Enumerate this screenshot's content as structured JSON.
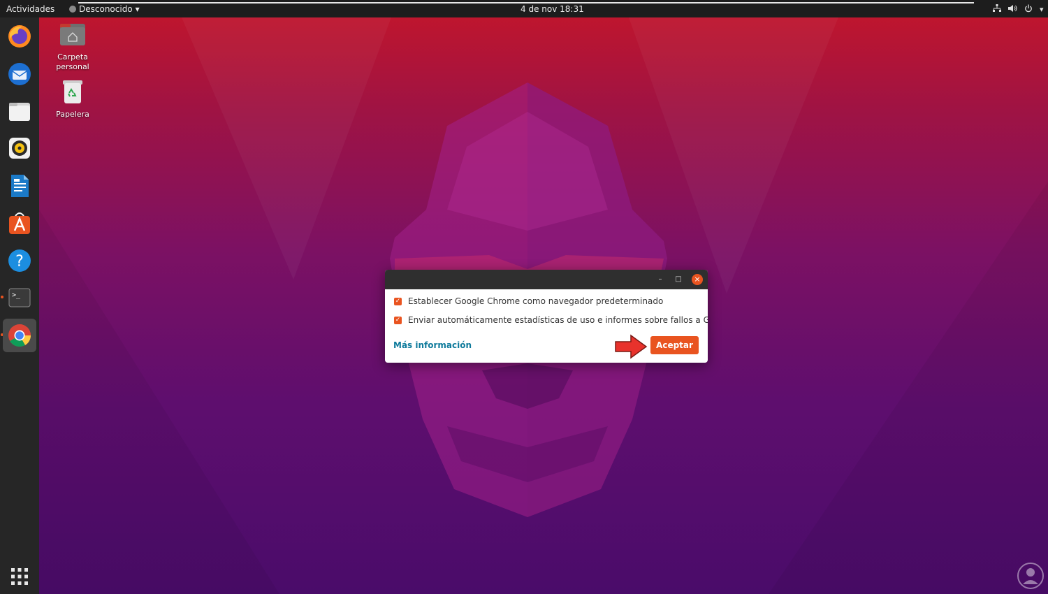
{
  "topbar": {
    "activities": "Actividades",
    "app_name": "Desconocido",
    "app_menu_caret": "▾",
    "clock": "4 de nov  18:31",
    "tray": {
      "network_icon": "network-icon",
      "volume_icon": "volume-icon",
      "power_icon": "power-icon",
      "menu_caret": "▾"
    }
  },
  "dock": {
    "items": [
      {
        "name": "firefox",
        "icon": "firefox-icon",
        "running": false,
        "active": false
      },
      {
        "name": "thunderbird",
        "icon": "thunderbird-icon",
        "running": false,
        "active": false
      },
      {
        "name": "files",
        "icon": "files-icon",
        "running": false,
        "active": false
      },
      {
        "name": "rhythmbox",
        "icon": "rhythmbox-icon",
        "running": false,
        "active": false
      },
      {
        "name": "libreoffice-writer",
        "icon": "writer-icon",
        "running": false,
        "active": false
      },
      {
        "name": "ubuntu-software",
        "icon": "software-icon",
        "running": false,
        "active": false
      },
      {
        "name": "help",
        "icon": "help-icon",
        "running": false,
        "active": false
      },
      {
        "name": "terminal",
        "icon": "terminal-icon",
        "running": true,
        "active": false
      },
      {
        "name": "google-chrome",
        "icon": "chrome-icon",
        "running": true,
        "active": true
      }
    ],
    "apps_grid_icon": "apps-grid-icon",
    "terminal_prompt": ">_",
    "help_glyph": "?"
  },
  "desktop": {
    "icons": [
      {
        "label_line1": "Carpeta",
        "label_line2": "personal",
        "icon": "home-folder-icon"
      },
      {
        "label_line1": "Papelera",
        "icon": "trash-icon"
      }
    ]
  },
  "dialog": {
    "minimize_glyph": "–",
    "maximize_glyph": "□",
    "close_glyph": "×",
    "checkbox_glyph": "✓",
    "options": [
      {
        "label": "Establecer Google Chrome como navegador predeterminado",
        "checked": true
      },
      {
        "label": "Enviar automáticamente estadísticas de uso e informes sobre fallos a Google",
        "checked": true
      }
    ],
    "more_info_link": "Más información",
    "accept_button": "Aceptar"
  },
  "colors": {
    "accent": "#e95420",
    "link": "#0f7b9c",
    "topbar_bg": "#1d1d1d",
    "dock_bg": "#262626",
    "annotation_arrow": "#e8322c"
  }
}
